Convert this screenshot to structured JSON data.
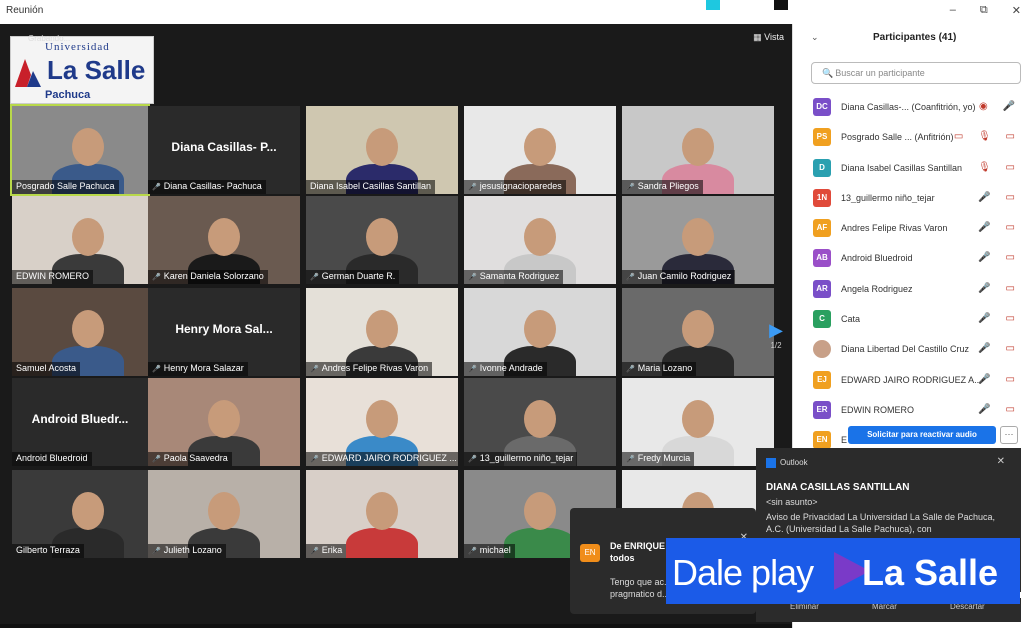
{
  "window": {
    "title": "Reunión",
    "buttons": [
      "–",
      "⧉",
      "✕"
    ]
  },
  "meeting": {
    "recording": "Grabando...",
    "view_label": "Vista",
    "logo": {
      "line1": "Universidad",
      "line2": "La Salle",
      "line3": "Pachuca"
    },
    "page": "1/2",
    "tiles": [
      {
        "name": "Posgrado Salle Pachuca",
        "mic_off": false,
        "shirt": "#3a5a8a",
        "bg": "#8a8a8a",
        "active": true
      },
      {
        "name": "Diana Casillas- Pachuca",
        "big": "Diana Casillas- P...",
        "mic_off": true
      },
      {
        "name": "Diana Isabel Casillas Santillan",
        "mic_off": false,
        "shirt": "#2b2b6a",
        "bg": "#cfc7b0"
      },
      {
        "name": "jesusignacioparedes",
        "mic_off": true,
        "shirt": "#8a6a5a",
        "bg": "#e8e8e8"
      },
      {
        "name": "Sandra Pliegos",
        "mic_off": true,
        "shirt": "#d88aa0",
        "bg": "#c8c8c8"
      },
      {
        "name": "EDWIN ROMERO",
        "mic_off": false,
        "shirt": "#3a3a3a",
        "bg": "#d8d0c8"
      },
      {
        "name": "Karen Daniela Solorzano",
        "mic_off": true,
        "shirt": "#1a1a1a",
        "bg": "#6a5a50"
      },
      {
        "name": "German Duarte R.",
        "mic_off": true,
        "shirt": "#2a2a2a",
        "bg": "#4a4a4a"
      },
      {
        "name": "Samanta Rodriguez",
        "mic_off": true,
        "shirt": "#c8c8c8",
        "bg": "#e0dede"
      },
      {
        "name": "Juan Camilo Rodriguez",
        "mic_off": true,
        "shirt": "#2a2a3a",
        "bg": "#9a9a9a"
      },
      {
        "name": "Samuel Acosta",
        "mic_off": false,
        "shirt": "#3a5a8a",
        "bg": "#5a4a40"
      },
      {
        "name": "Henry Mora Salazar",
        "big": "Henry Mora Sal...",
        "mic_off": true
      },
      {
        "name": "Andres Felipe Rivas Varon",
        "mic_off": true,
        "shirt": "#3a3a3a",
        "bg": "#e4e0d8"
      },
      {
        "name": "Ivonne Andrade",
        "mic_off": true,
        "shirt": "#2a2a2a",
        "bg": "#d8d8d8"
      },
      {
        "name": "Maria Lozano",
        "mic_off": true,
        "shirt": "#2a2a2a",
        "bg": "#6a6a6a"
      },
      {
        "name": "Android Bluedroid",
        "big": "Android Bluedr...",
        "mic_off": false
      },
      {
        "name": "Paola Saavedra",
        "mic_off": true,
        "shirt": "#3a3a3a",
        "bg": "#a88878"
      },
      {
        "name": "EDWARD JAIRO RODRIGUEZ ...",
        "mic_off": true,
        "shirt": "#3a8ac8",
        "bg": "#e8e0d8"
      },
      {
        "name": "13_guillermo niño_tejar",
        "mic_off": true,
        "shirt": "#6a6a6a",
        "bg": "#4a4a4a"
      },
      {
        "name": "Fredy Murcia",
        "mic_off": true,
        "shirt": "#d8d8d8",
        "bg": "#e8e8e8"
      },
      {
        "name": "Gilberto Terraza",
        "mic_off": false,
        "shirt": "#2a2a2a",
        "bg": "#3a3a3a"
      },
      {
        "name": "Julieth Lozano",
        "mic_off": true,
        "shirt": "#3a3a3a",
        "bg": "#b8b0a8"
      },
      {
        "name": "Erika",
        "mic_off": true,
        "shirt": "#c83a3a",
        "bg": "#d8cfc8"
      },
      {
        "name": "michael",
        "mic_off": true,
        "shirt": "#3a8a4a",
        "bg": "#8a8a8a"
      },
      {
        "name": "",
        "mic_off": false,
        "shirt": "#d8c8b8",
        "bg": "#e8e8e8"
      }
    ],
    "chat": {
      "avatar": "EN",
      "from": "De ENRIQUE NOSSA para todos",
      "message": "Tengo que ac... pragmatico d..."
    },
    "toolbar": {
      "participants_count": "41"
    }
  },
  "participants_panel": {
    "title": "Participantes (41)",
    "search_placeholder": "Buscar un participante",
    "items": [
      {
        "initials": "DC",
        "color": "#7a4fc8",
        "name": "Diana Casillas-... (Coanfitrión, yo)",
        "icons": "◉ 🎤"
      },
      {
        "initials": "PS",
        "color": "#f0a020",
        "name": "Posgrado Salle ... (Anfitrión)",
        "icons": "▭ 🎙 ▭"
      },
      {
        "initials": "D",
        "color": "#2aa0b0",
        "name": "Diana Isabel Casillas Santillan",
        "icons": "🎙 ▭"
      },
      {
        "initials": "1N",
        "color": "#e04a3a",
        "name": "13_guillermo niño_tejar",
        "icons": "🎤 ▭"
      },
      {
        "initials": "AF",
        "color": "#f0a020",
        "name": "Andres Felipe Rivas Varon",
        "icons": "🎤 ▭"
      },
      {
        "initials": "AB",
        "color": "#9a4fc8",
        "name": "Android Bluedroid",
        "icons": "🎤 ▭"
      },
      {
        "initials": "AR",
        "color": "#7a4fc8",
        "name": "Angela Rodriguez",
        "icons": "🎤 ▭"
      },
      {
        "initials": "C",
        "color": "#2aa060",
        "name": "Cata",
        "icons": "🎤 ▭"
      },
      {
        "initials": "",
        "color": "#c8a088",
        "name": "Diana Libertad Del Castillo Cruz",
        "icons": "🎤 ▭"
      },
      {
        "initials": "EJ",
        "color": "#f0a020",
        "name": "EDWARD JAIRO RODRIGUEZ A...",
        "icons": "🎤 ▭"
      },
      {
        "initials": "ER",
        "color": "#7a4fc8",
        "name": "EDWIN ROMERO",
        "icons": "🎤 ▭"
      },
      {
        "initials": "EN",
        "color": "#f0a020",
        "name": "E",
        "icons": ""
      }
    ],
    "unmute_button": "Solicitar para reactivar audio",
    "more_button": "···"
  },
  "outlook_toast": {
    "app": "Outlook",
    "sender": "DIANA CASILLAS SANTILLAN",
    "subject": "<sin asunto>",
    "body": "Aviso de Privacidad La Universidad La Salle de Pachuca, A.C. (Universidad La Salle Pachuca), con",
    "actions": [
      "Eliminar",
      "Marcar",
      "Descartar"
    ]
  },
  "banner": {
    "text1": "Dale play",
    "text2": "La Salle"
  }
}
